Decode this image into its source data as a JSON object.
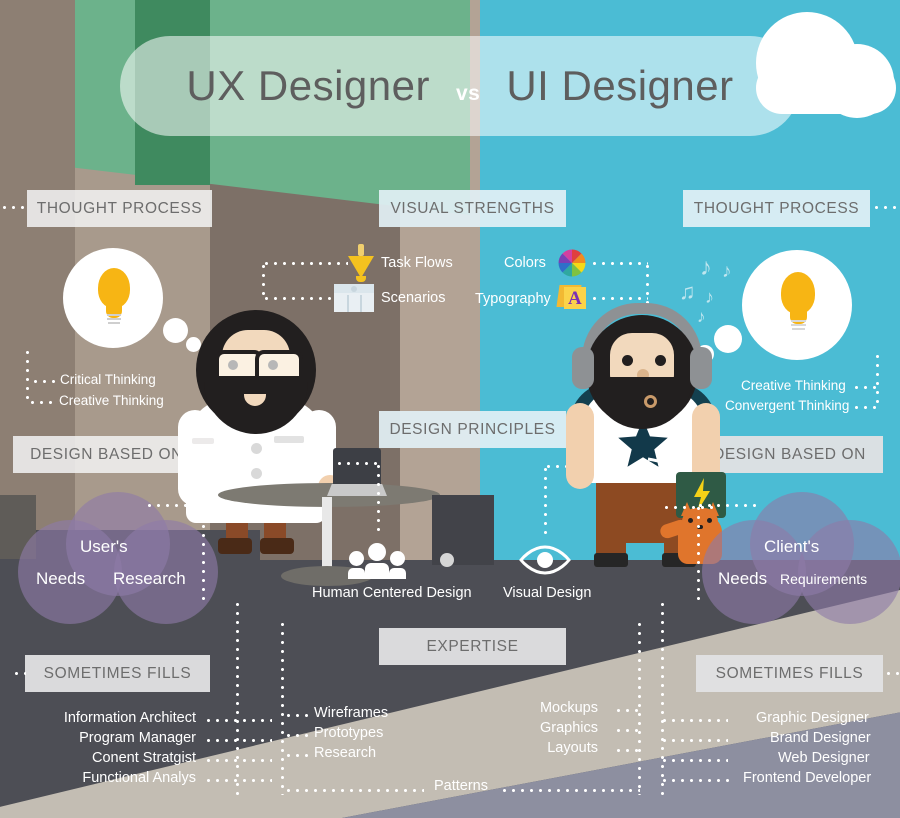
{
  "header": {
    "left_title": "UX Designer",
    "vs": "vs",
    "right_title": "UI Designer"
  },
  "sections": {
    "thought_process_left": "THOUGHT PROCESS",
    "visual_strengths": "VISUAL STRENGTHS",
    "thought_process_right": "THOUGHT PROCESS",
    "design_based_on_left": "DESIGN BASED ON",
    "design_principles": "DESIGN PRINCIPLES",
    "design_based_on_right": "DESIGN BASED ON",
    "sometimes_fills_left": "SOMETIMES FILLS",
    "expertise": "EXPERTISE",
    "sometimes_fills_right": "SOMETIMES FILLS"
  },
  "ux": {
    "thinking": [
      "Critical  Thinking",
      "Creative Thinking"
    ],
    "venn": {
      "top": "User's",
      "left": "Needs",
      "right": "Research"
    },
    "fills": [
      "Information Architect",
      "Program Manager",
      "Conent Stratgist",
      "Functional Analys"
    ],
    "expertise": [
      "Wireframes",
      "Prototypes",
      "Research"
    ]
  },
  "ui": {
    "thinking": [
      "Creative Thinking",
      "Convergent Thinking"
    ],
    "venn": {
      "top": "Client's",
      "left": "Needs",
      "right": "Requirements"
    },
    "fills": [
      "Graphic Designer",
      "Brand Designer",
      "Web Designer",
      "Frontend Developer"
    ],
    "expertise": [
      "Mockups",
      "Graphics",
      "Layouts"
    ]
  },
  "center": {
    "visual_strengths_left": [
      {
        "label": "Task Flows",
        "icon": "funnel-icon"
      },
      {
        "label": "Scenarios",
        "icon": "window-grid-icon"
      }
    ],
    "visual_strengths_right": [
      {
        "label": "Colors",
        "icon": "color-wheel-icon"
      },
      {
        "label": "Typography",
        "icon": "font-folder-icon"
      }
    ],
    "principles": [
      {
        "label": "Human Centered Design",
        "icon": "people-group-icon"
      },
      {
        "label": "Visual Design",
        "icon": "eye-icon"
      }
    ],
    "shared_expertise": "Patterns"
  },
  "colors": {
    "sky": "#4bbcd4",
    "wall": "#8d7f73",
    "green_board": "#6cb28b",
    "floor": "#4d4e55",
    "bulb_yellow": "#f7b514",
    "venn_purple": "#8e7aa8",
    "chip_text": "#6d6d6d",
    "title_text": "#5e5e5e"
  }
}
